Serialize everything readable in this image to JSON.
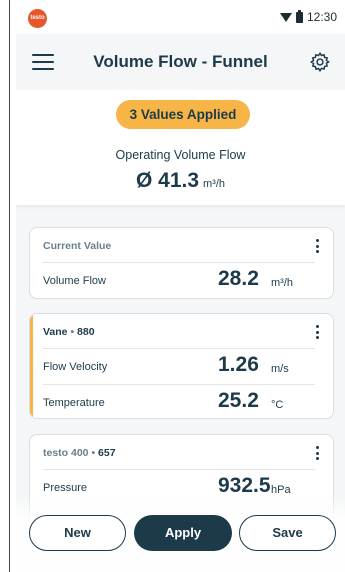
{
  "status_bar": {
    "time": "12:30",
    "logo_text": "testo"
  },
  "header": {
    "title": "Volume Flow - Funnel"
  },
  "summary": {
    "badge": "3 Values Applied",
    "label": "Operating Volume Flow",
    "value": "Ø 41.3",
    "unit": "m³/h"
  },
  "cards": [
    {
      "title": "Current Value",
      "rows": [
        {
          "label": "Volume Flow",
          "value": "28.2",
          "unit": "m³/h"
        }
      ]
    },
    {
      "title_name": "Vane",
      "title_sep": " • ",
      "title_id": "880",
      "rows": [
        {
          "label": "Flow Velocity",
          "value": "1.26",
          "unit": "m/s"
        },
        {
          "label": "Temperature",
          "value": "25.2",
          "unit": "°C"
        }
      ]
    },
    {
      "title_name": "testo 400",
      "title_sep": " • ",
      "title_id": "657",
      "rows": [
        {
          "label": "Pressure",
          "value": "932.5",
          "unit": "hPa"
        }
      ]
    }
  ],
  "buttons": {
    "new": "New",
    "apply": "Apply",
    "save": "Save"
  },
  "colors": {
    "accent": "#f7b547",
    "primary": "#1d3a4a",
    "logo": "#e8552b"
  },
  "icons": [
    "menu-icon",
    "gear-icon",
    "more-vert-icon",
    "wifi-icon",
    "battery-icon"
  ]
}
